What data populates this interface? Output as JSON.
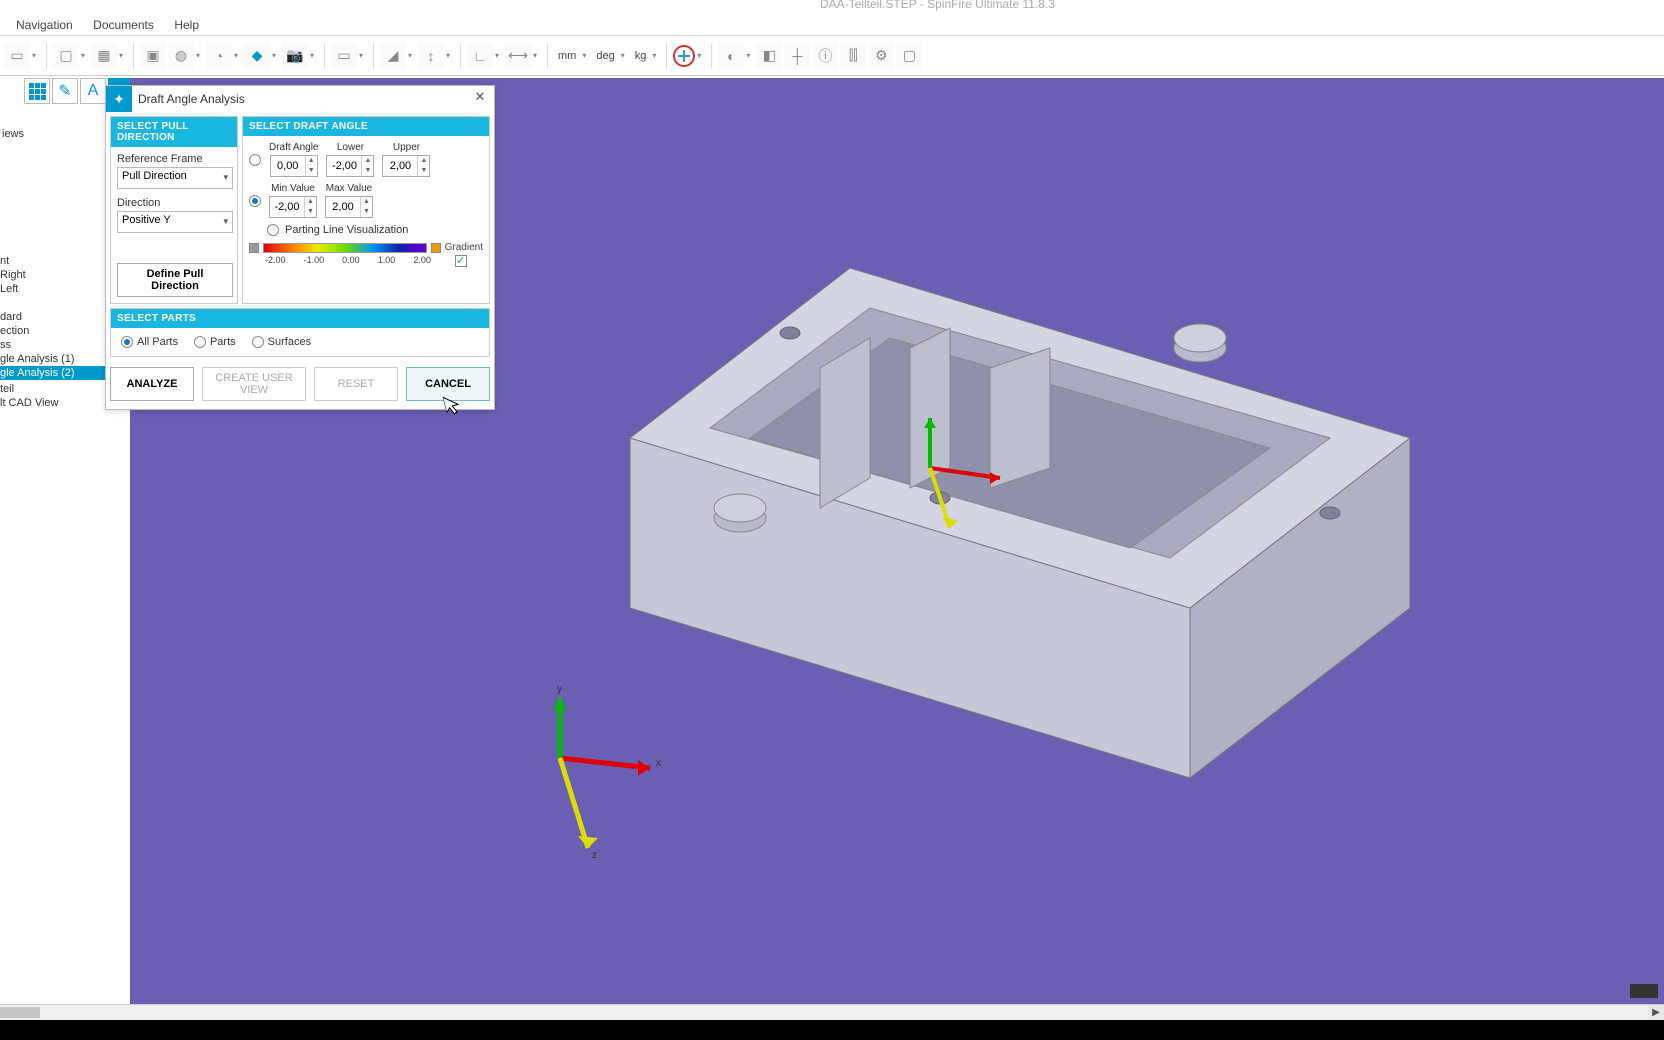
{
  "app_title": "DAA-Teilteil.STEP - SpinFire Ultimate 11.8.3",
  "menu": {
    "navigation": "Navigation",
    "documents": "Documents",
    "help": "Help"
  },
  "units": {
    "length": "mm",
    "angle": "deg",
    "mass": "kg"
  },
  "left_panel": {
    "header": "iews",
    "items": [
      "nt",
      " Right",
      " Left",
      "dard",
      "ection",
      "ss",
      "gle Analysis (1)",
      "gle Analysis (2)",
      "",
      "teil",
      "lt CAD View"
    ],
    "selected_index": 7
  },
  "dialog": {
    "title": "Draft Angle Analysis",
    "pull_section": {
      "header": "SELECT PULL DIRECTION",
      "ref_frame_label": "Reference Frame",
      "ref_frame_value": "Pull Direction",
      "direction_label": "Direction",
      "direction_value": "Positive Y",
      "define_btn": "Define Pull Direction"
    },
    "angle_section": {
      "header": "SELECT DRAFT ANGLE",
      "mode1_labels": {
        "draft": "Draft Angle",
        "lower": "Lower",
        "upper": "Upper"
      },
      "mode1_values": {
        "draft": "0,00",
        "lower": "-2,00",
        "upper": "2,00"
      },
      "mode2_labels": {
        "min": "Min Value",
        "max": "Max Value"
      },
      "mode2_values": {
        "min": "-2,00",
        "max": "2,00"
      },
      "parting_label": "Parting Line Visualization",
      "gradient_label": "Gradient",
      "gradient_ticks": [
        "-2.00",
        "-1.00",
        "0.00",
        "1.00",
        "2.00"
      ]
    },
    "parts_section": {
      "header": "SELECT PARTS",
      "all": "All Parts",
      "parts": "Parts",
      "surfaces": "Surfaces"
    },
    "buttons": {
      "analyze": "ANALYZE",
      "create_user_view": "CREATE USER VIEW",
      "reset": "RESET",
      "cancel": "CANCEL"
    }
  }
}
